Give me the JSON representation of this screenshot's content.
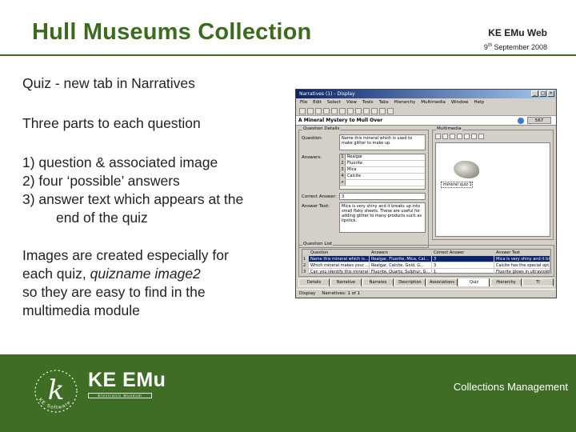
{
  "header": {
    "title": "Hull Museums Collection",
    "brand": "KE EMu Web",
    "date_day": "9",
    "date_suffix": "th",
    "date_rest": " September 2008"
  },
  "body": {
    "heading": "Quiz - new tab in Narratives",
    "subhead": "Three parts to each question",
    "list": [
      "1) question & associated image",
      "2) four ‘possible’ answers",
      "3) answer text which appears at the",
      "end of the quiz"
    ],
    "para_line1": "Images are created especially for",
    "para_line2_prefix": "each quiz, ",
    "para_line2_italic": "quizname image2",
    "para_line3": "so they are easy to find in the",
    "para_line4": "multimedia module"
  },
  "screenshot": {
    "window_title": "Narratives (1) - Display",
    "menu": [
      "File",
      "Edit",
      "Select",
      "View",
      "Tools",
      "Tabs",
      "Hierarchy",
      "Multimedia",
      "Window",
      "Help"
    ],
    "record_title": "A Mineral Mystery to Mull Over",
    "record_number": "567",
    "question_details_legend": "Question Details",
    "question_label": "Question:",
    "question_text": "Name this mineral which is used to make glitter to make up.",
    "answers_label": "Answers:",
    "answers": [
      "Realgar",
      "Fluorite",
      "Mica",
      "Calcite"
    ],
    "correct_answer_label": "Correct Answer:",
    "correct_answer_value": "3",
    "answer_text_label": "Answer Text:",
    "answer_text_value": "Mica is very shiny and it breaks up into small flaky sheets. These are useful for adding glitter to many products such as lipstick.",
    "multimedia_legend": "Multimedia",
    "multimedia_caption": "mineral quiz 1",
    "question_list_legend": "Question List",
    "grid_headers": [
      "Question",
      "Answers",
      "Correct Answer",
      "Answer Text"
    ],
    "grid_rows": [
      [
        "1",
        "Name this mineral which is...",
        "Realgar, Fluorite, Mica, Cal...",
        "3",
        "Mica is very shiny and it br..."
      ],
      [
        "2",
        "Which mineral makes your ...",
        "Realgar, Calcite, Gold, G...",
        "3",
        "Calcite has the special opt..."
      ],
      [
        "3",
        "Can you identify this mineral...",
        "Fluorite, Quartz, Sulphur, G...",
        "1",
        "Fluorite glows in ultraviolet..."
      ]
    ],
    "tabs": [
      "Details",
      "Narrative",
      "Narrates",
      "Description",
      "Associations",
      "Quiz",
      "Hierarchy",
      "Ti"
    ],
    "active_tab_index": 5,
    "status_mode": "Display",
    "status_record": "Narratives: 1 of 1"
  },
  "footer": {
    "logo_letter": "k",
    "logo_ring_text": "KE Software",
    "logo_name": "KE EMu",
    "logo_tagline": "Electronic Museum",
    "section_label": "Collections Management"
  },
  "colors": {
    "brand_green": "#3f6d25",
    "title_green": "#3b6b1c"
  }
}
